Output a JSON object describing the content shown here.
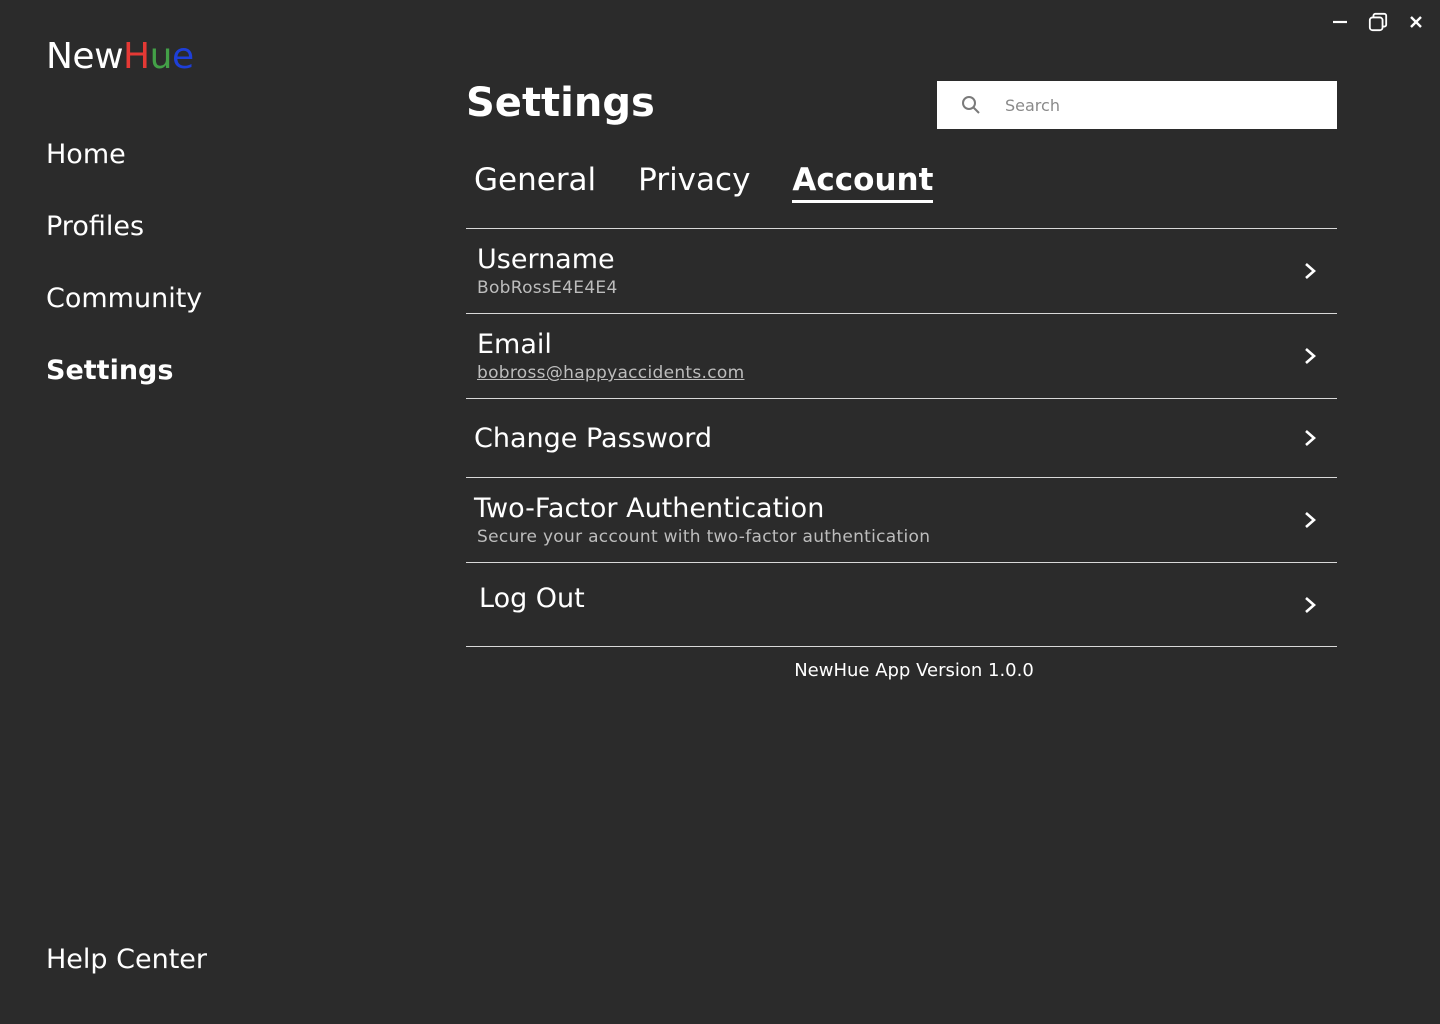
{
  "window": {
    "minimize_icon": "minimize-icon",
    "restore_icon": "restore-icon",
    "close_icon": "close-icon"
  },
  "logo": {
    "parts": [
      {
        "text": "New",
        "color": "#ffffff"
      },
      {
        "text": "H",
        "color": "#e53935"
      },
      {
        "text": "u",
        "color": "#43a047"
      },
      {
        "text": "e",
        "color": "#1e3fd8"
      }
    ]
  },
  "sidebar": {
    "items": [
      {
        "label": "Home"
      },
      {
        "label": "Profiles"
      },
      {
        "label": "Community"
      },
      {
        "label": "Settings",
        "active": true
      }
    ],
    "help": "Help Center"
  },
  "main": {
    "title": "Settings",
    "search": {
      "placeholder": "Search",
      "value": "",
      "icon": "search-icon"
    },
    "tabs": [
      {
        "label": "General"
      },
      {
        "label": "Privacy"
      },
      {
        "label": "Account",
        "active": true
      }
    ],
    "rows": [
      {
        "title": "Username",
        "sub": "BobRossE4E4E4"
      },
      {
        "title": "Email",
        "sub": "bobross@happyaccidents.com"
      },
      {
        "title": "Change Password",
        "sub": ""
      },
      {
        "title": "Two-Factor Authentication",
        "sub": "Secure your account with two-factor authentication"
      },
      {
        "title": "Log Out",
        "sub": ""
      }
    ],
    "version": "NewHue App Version 1.0.0"
  }
}
